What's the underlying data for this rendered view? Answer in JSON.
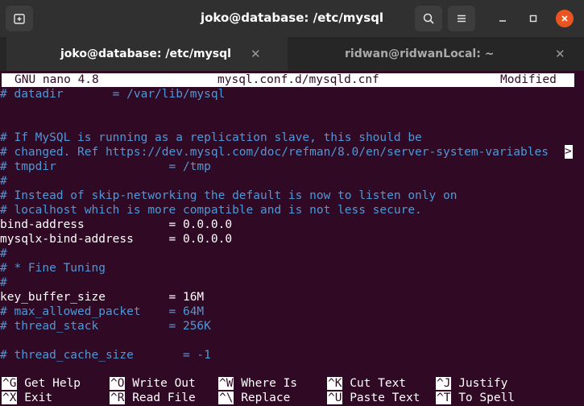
{
  "window": {
    "title": "joko@database: /etc/mysql",
    "tabs": [
      {
        "label": "joko@database: /etc/mysql",
        "active": true
      },
      {
        "label": "ridwan@ridwanLocal: ~",
        "active": false
      }
    ],
    "icons": {
      "new_tab": "new-tab-icon",
      "search": "search-icon",
      "menu": "hamburger-menu-icon",
      "minimize": "minimize-icon",
      "maximize": "maximize-icon",
      "close": "close-icon",
      "tab_close": "close-icon"
    },
    "close_color": "#e95420"
  },
  "nano": {
    "version": "GNU nano 4.8",
    "filename": "mysql.conf.d/mysqld.cnf",
    "status": "Modified",
    "lines": [
      {
        "text": "# datadir       = /var/lib/mysql",
        "comment": true
      },
      {
        "text": "",
        "comment": false
      },
      {
        "text": "",
        "comment": false
      },
      {
        "text": "# If MySQL is running as a replication slave, this should be",
        "comment": true
      },
      {
        "text": "# changed. Ref https://dev.mysql.com/doc/refman/8.0/en/server-system-variables",
        "comment": true
      },
      {
        "text": "# tmpdir                = /tmp",
        "comment": true
      },
      {
        "text": "#",
        "comment": true
      },
      {
        "text": "# Instead of skip-networking the default is now to listen only on",
        "comment": true
      },
      {
        "text": "# localhost which is more compatible and is not less secure.",
        "comment": true
      },
      {
        "text": "bind-address            = 0.0.0.0",
        "comment": false
      },
      {
        "text": "mysqlx-bind-address     = 0.0.0.0",
        "comment": false
      },
      {
        "text": "#",
        "comment": true
      },
      {
        "text": "# * Fine Tuning",
        "comment": true
      },
      {
        "text": "#",
        "comment": true
      },
      {
        "text": "key_buffer_size         = 16M",
        "comment": false
      },
      {
        "text": "# max_allowed_packet    = 64M",
        "comment": true
      },
      {
        "text": "# thread_stack          = 256K",
        "comment": true
      },
      {
        "text": "",
        "comment": false
      },
      {
        "text": "# thread_cache_size       = -1",
        "comment": true
      }
    ],
    "truncation_marker": ">",
    "shortcuts_row1": [
      {
        "key": "^G",
        "label": "Get Help"
      },
      {
        "key": "^O",
        "label": "Write Out"
      },
      {
        "key": "^W",
        "label": "Where Is"
      },
      {
        "key": "^K",
        "label": "Cut Text"
      },
      {
        "key": "^J",
        "label": "Justify"
      }
    ],
    "shortcuts_row2": [
      {
        "key": "^X",
        "label": "Exit"
      },
      {
        "key": "^R",
        "label": "Read File"
      },
      {
        "key": "^\\",
        "label": "Replace"
      },
      {
        "key": "^U",
        "label": "Paste Text"
      },
      {
        "key": "^T",
        "label": "To Spell"
      }
    ],
    "colors": {
      "background": "#300a24",
      "comment": "#4f97d7",
      "text": "#ffffff"
    }
  }
}
